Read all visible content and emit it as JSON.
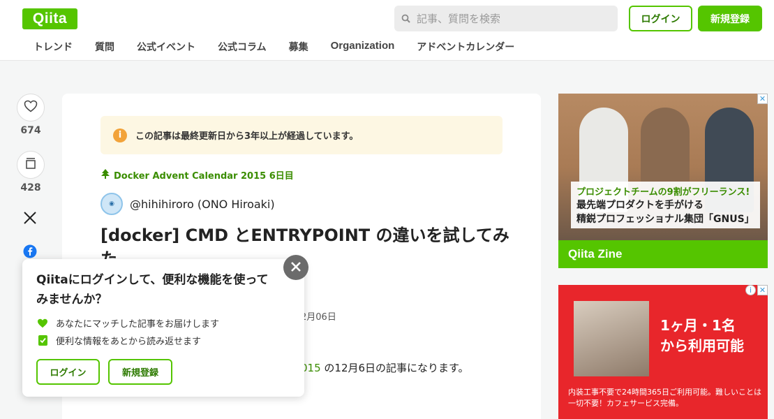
{
  "header": {
    "logo": "Qiita",
    "search_placeholder": "記事、質問を検索",
    "login_label": "ログイン",
    "signup_label": "新規登録"
  },
  "nav": {
    "items": [
      "トレンド",
      "質問",
      "公式イベント",
      "公式コラム",
      "募集",
      "Organization",
      "アドベントカレンダー"
    ]
  },
  "rail": {
    "likes": "674",
    "stocks": "428"
  },
  "article": {
    "notice": "この記事は最終更新日から3年以上が経過しています。",
    "advent": "Docker Advent Calendar 2015 6日目",
    "author": "@hihihiroro (ONO Hiroaki)",
    "title": "[docker] CMD とENTRYPOINT の違いを試してみた",
    "date_fragment": "2月06日",
    "intro_link": "015",
    "intro_text": " の12月6日の記事になります。"
  },
  "popup": {
    "title": "Qiitaにログインして、便利な機能を使ってみませんか？",
    "features": [
      "あなたにマッチした記事をお届けします",
      "便利な情報をあとから読み返せます"
    ],
    "login_label": "ログイン",
    "signup_label": "新規登録"
  },
  "ads": {
    "ad1": {
      "line1": "プロジェクトチームの9割がフリーランス!",
      "line2": "最先端プロダクトを手がける",
      "line3": "精鋭プロフェッショナル集団「GNUS」",
      "brand": "Qiita Zine"
    },
    "ad2": {
      "headline1": "1ヶ月・1名",
      "headline2": "から利用可能",
      "body": "内装工事不要で24時間365日ご利用可能。難しいことは一切不要！カフェサービス完備。"
    }
  },
  "colors": {
    "brand": "#55c500",
    "brand_dark": "#3a8d00",
    "notice_bg": "#fdf7e3",
    "ad_red": "#e8262b"
  }
}
